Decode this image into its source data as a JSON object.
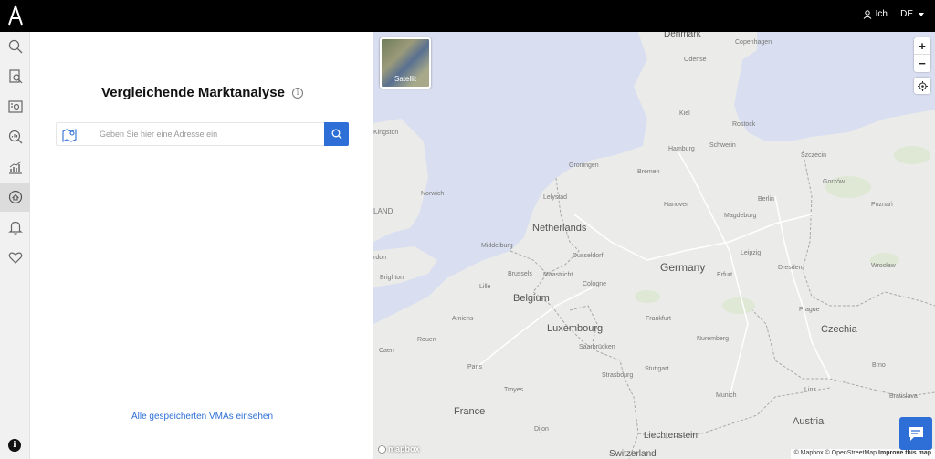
{
  "topbar": {
    "user_label": "Ich",
    "language_label": "DE"
  },
  "sidebar": {
    "items": [
      {
        "icon": "search-icon"
      },
      {
        "icon": "document-search-icon"
      },
      {
        "icon": "listing-icon"
      },
      {
        "icon": "analysis-icon"
      },
      {
        "icon": "chart-icon"
      },
      {
        "icon": "market-compare-icon",
        "active": true
      },
      {
        "icon": "bell-icon"
      },
      {
        "icon": "heart-icon"
      }
    ]
  },
  "panel": {
    "title": "Vergleichende Marktanalyse",
    "search_placeholder": "Geben Sie hier eine Adresse ein",
    "saved_link": "Alle gespeicherten VMAs einsehen"
  },
  "map": {
    "satellite_label": "Satellit",
    "zoom_in": "+",
    "zoom_out": "−",
    "mapbox_label": "mapbox",
    "attribution": {
      "mapbox": "© Mapbox",
      "osm": "© OpenStreetMap",
      "improve": "Improve this map"
    },
    "countries": {
      "denmark": "Denmark",
      "netherlands": "Netherlands",
      "belgium": "Belgium",
      "luxembourg": "Luxembourg",
      "germany": "Germany",
      "france": "France",
      "czechia": "Czechia",
      "austria": "Austria",
      "liechtenstein": "Liechtenstein",
      "switzerland": "Switzerland",
      "england_fragment": "LAND"
    },
    "cities": {
      "copenhagen": "Copenhagen",
      "odense": "Odense",
      "kiel": "Kiel",
      "rostock": "Rostock",
      "hamburg": "Hamburg",
      "schwerin": "Schwerin",
      "szczecin": "Szczecin",
      "groningen": "Groningen",
      "bremen": "Bremen",
      "lelystad": "Lelystad",
      "hanover": "Hanover",
      "berlin": "Berlin",
      "magdeburg": "Magdeburg",
      "gorzow": "Gorzów",
      "poznan": "Poznań",
      "kingston": "Kingston",
      "norwich": "Norwich",
      "middelburg": "Middelburg",
      "dusseldorf": "Dusseldorf",
      "leipzig": "Leipzig",
      "brussels": "Brussels",
      "maastricht": "Maastricht",
      "lille": "Lille",
      "cologne": "Cologne",
      "erfurt": "Erfurt",
      "dresden": "Dresden",
      "wroclaw": "Wrocław",
      "brighton": "Brighton",
      "amiens": "Amiens",
      "frankfurt": "Frankfurt",
      "prague": "Prague",
      "rouen": "Rouen",
      "saarbrucken": "Saarbrücken",
      "nuremberg": "Nuremberg",
      "paris": "Paris",
      "strasbourg": "Strasbourg",
      "stuttgart": "Stuttgart",
      "munich": "Munich",
      "troyes": "Troyes",
      "linz": "Linz",
      "brno": "Brno",
      "bratislava": "Bratislava",
      "dijon": "Dijon",
      "caen_fragment": "Caen",
      "rdon_fragment": "rdon"
    }
  }
}
